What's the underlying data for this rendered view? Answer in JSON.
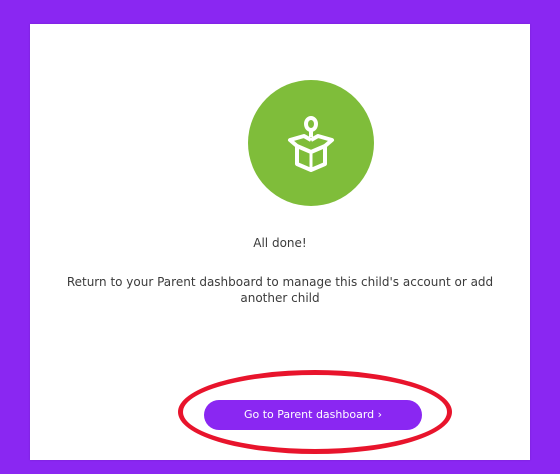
{
  "page": {
    "hero_icon": "child-in-box-icon",
    "title": "All done!",
    "message": "Return to your Parent dashboard to manage this child's account or add another child",
    "cta_label": "Go to Parent dashboard ›"
  },
  "colors": {
    "brand_purple": "#8a27f2",
    "success_green": "#7fbd3a",
    "annotation_red": "#e8142c"
  }
}
